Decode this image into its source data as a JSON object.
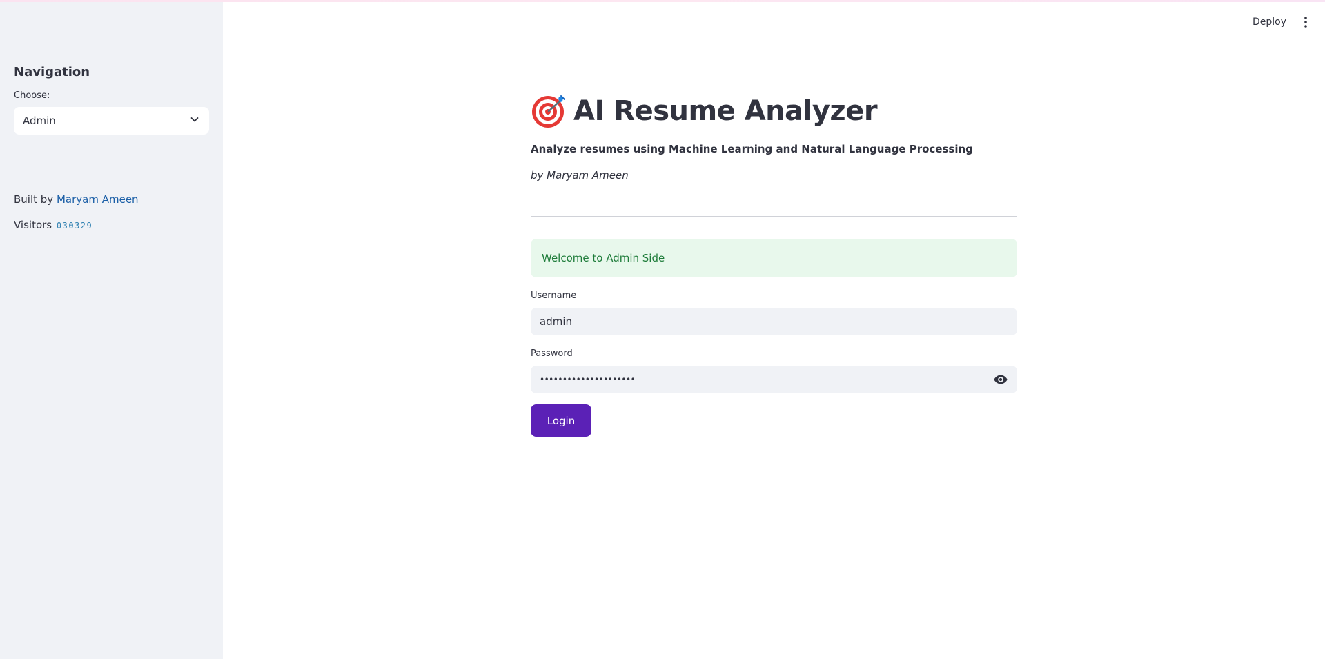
{
  "sidebar": {
    "heading": "Navigation",
    "choose_label": "Choose:",
    "selected_option": "Admin",
    "built_by_prefix": "Built by",
    "built_by_name": "Maryam Ameen",
    "visitors_label": "Visitors",
    "visitors_count": "030329"
  },
  "topbar": {
    "deploy_label": "Deploy",
    "menu_icon": "kebab-menu-icon"
  },
  "main": {
    "title_icon": "target-icon",
    "title": "AI Resume Analyzer",
    "subtitle": "Analyze resumes using Machine Learning and Natural Language Processing",
    "byline": "by Maryam Ameen",
    "alert_text": "Welcome to Admin Side",
    "username_label": "Username",
    "username_value": "admin",
    "password_label": "Password",
    "password_masked": "•••••••••••••••••••••",
    "login_label": "Login"
  },
  "colors": {
    "accent": "#5b21b6",
    "sidebar_bg": "#f0f2f6",
    "success_bg": "#e8f8ec",
    "success_text": "#1e7c3a",
    "link": "#1b5fa7"
  }
}
